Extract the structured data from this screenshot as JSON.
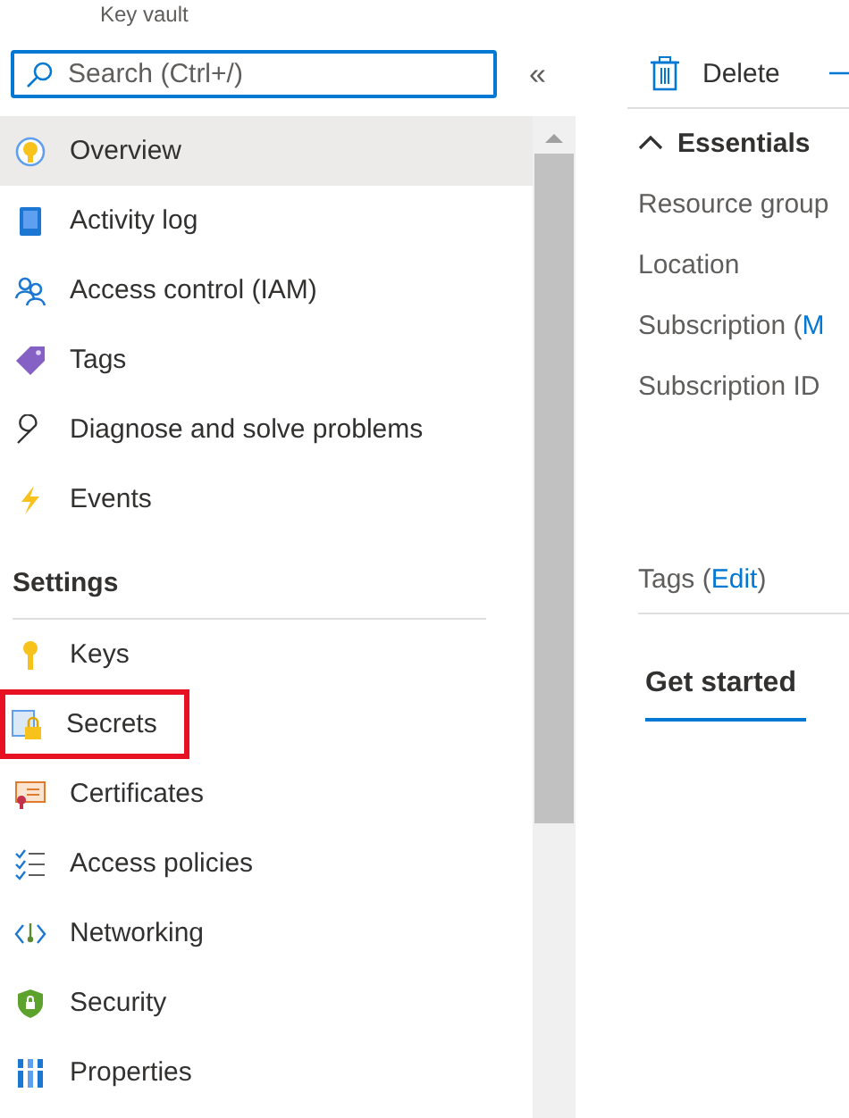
{
  "header": {
    "subtitle": "Key vault"
  },
  "search": {
    "placeholder": "Search (Ctrl+/)",
    "collapse": "«"
  },
  "sidebar": {
    "groups": [
      {
        "items": [
          {
            "label": "Overview",
            "selected": true,
            "highlighted": false
          },
          {
            "label": "Activity log",
            "selected": false,
            "highlighted": false
          },
          {
            "label": "Access control (IAM)",
            "selected": false,
            "highlighted": false
          },
          {
            "label": "Tags",
            "selected": false,
            "highlighted": false
          },
          {
            "label": "Diagnose and solve problems",
            "selected": false,
            "highlighted": false
          },
          {
            "label": "Events",
            "selected": false,
            "highlighted": false
          }
        ]
      },
      {
        "title": "Settings",
        "items": [
          {
            "label": "Keys",
            "selected": false,
            "highlighted": false
          },
          {
            "label": "Secrets",
            "selected": false,
            "highlighted": true
          },
          {
            "label": "Certificates",
            "selected": false,
            "highlighted": false
          },
          {
            "label": "Access policies",
            "selected": false,
            "highlighted": false
          },
          {
            "label": "Networking",
            "selected": false,
            "highlighted": false
          },
          {
            "label": "Security",
            "selected": false,
            "highlighted": false
          },
          {
            "label": "Properties",
            "selected": false,
            "highlighted": false
          }
        ]
      }
    ]
  },
  "toolbar": {
    "buttons": [
      {
        "label": "Delete"
      }
    ]
  },
  "essentials": {
    "title": "Essentials",
    "expanded": true,
    "fields": [
      {
        "label": "Resource group"
      },
      {
        "label": "Location"
      },
      {
        "label": "Subscription (",
        "link": "M"
      },
      {
        "label": "Subscription ID"
      }
    ],
    "tags": {
      "label": "Tags (",
      "link": "Edit",
      "suffix": ")"
    }
  },
  "tabs": [
    {
      "label": "Get started",
      "selected": true
    }
  ]
}
